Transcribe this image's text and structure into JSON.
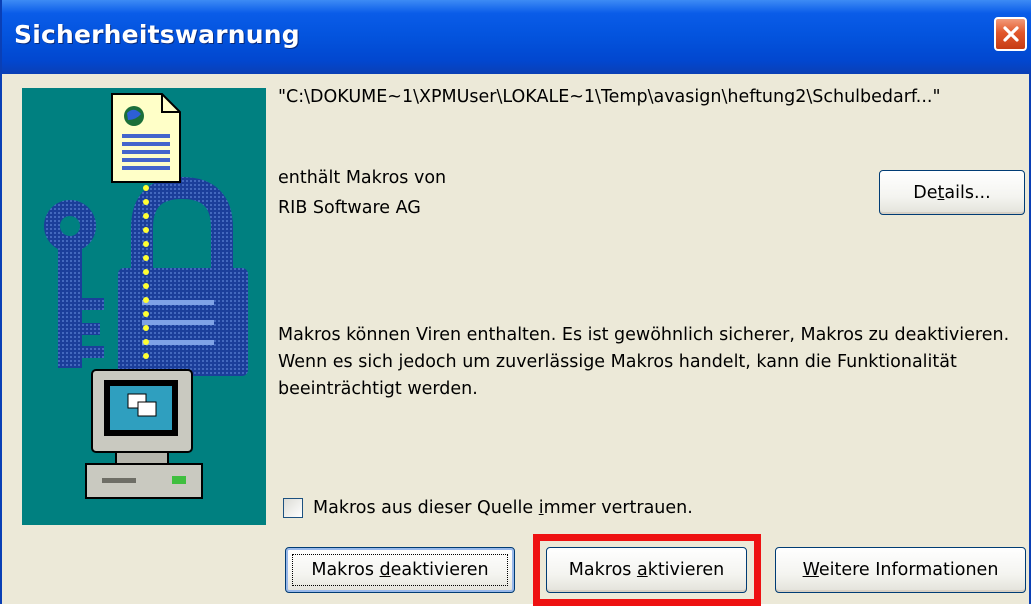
{
  "window": {
    "title": "Sicherheitswarnung"
  },
  "dialog": {
    "file_path": "\"C:\\DOKUME~1\\XPMUser\\LOKALE~1\\Temp\\avasign\\heftung2\\Schulbedarf...\"",
    "macros_from_label": "enthält Makros von",
    "publisher": "RIB Software AG",
    "warning_text": "Makros können Viren enthalten. Es ist gewöhnlich sicherer, Makros zu deaktivieren. Wenn es sich jedoch um zuverlässige Makros handelt, kann die Funktionalität beeinträchtigt werden.",
    "trust_checkbox": {
      "label_pre": "Makros aus dieser Quelle ",
      "label_hotkey": "i",
      "label_post": "mmer vertrauen.",
      "checked": false
    }
  },
  "buttons": {
    "details": {
      "pre": "De",
      "hotkey": "t",
      "post": "ails..."
    },
    "deactivate": {
      "pre": "Makros ",
      "hotkey": "d",
      "post": "eaktivieren"
    },
    "activate": {
      "pre": "Makros ",
      "hotkey": "a",
      "post": "ktivieren"
    },
    "more_info": {
      "pre": "",
      "hotkey": "W",
      "post": "eitere Informationen"
    }
  },
  "icons": {
    "close": "close-icon",
    "security_art": "macro-security-illustration"
  },
  "colors": {
    "title_bar": "#0353dd",
    "art_background": "#008080",
    "highlight_frame": "#ee1111",
    "dialog_background": "#ece9d8",
    "close_button": "#e2582c"
  }
}
